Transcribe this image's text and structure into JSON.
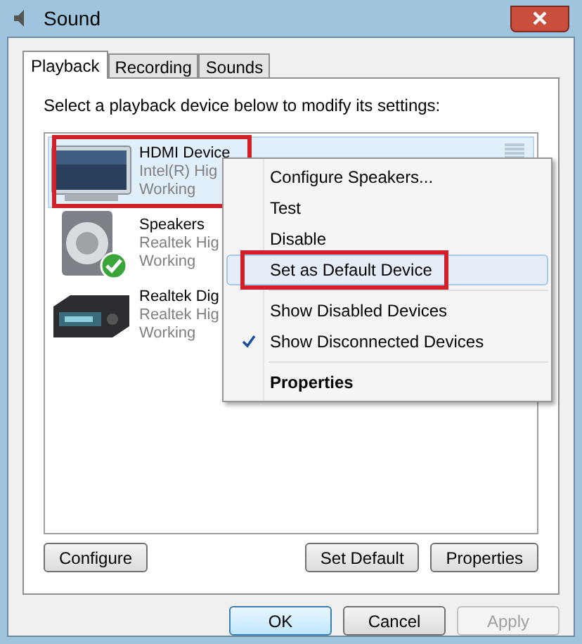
{
  "window": {
    "title": "Sound"
  },
  "tabs": [
    {
      "label": "Playback",
      "selected": true
    },
    {
      "label": "Recording",
      "selected": false
    },
    {
      "label": "Sounds",
      "selected": false
    }
  ],
  "instruction": "Select a playback device below to modify its settings:",
  "devices": [
    {
      "kind": "monitor",
      "name": "HDMI Device",
      "driver": "Intel(R) Hig",
      "status": "Working",
      "selected": true,
      "default": false,
      "highlighted": true
    },
    {
      "kind": "speaker",
      "name": "Speakers",
      "driver": "Realtek Hig",
      "status": "Working",
      "selected": false,
      "default": true,
      "highlighted": false
    },
    {
      "kind": "receiver",
      "name": "Realtek Dig",
      "driver": "Realtek Hig",
      "status": "Working",
      "selected": false,
      "default": false,
      "highlighted": false
    }
  ],
  "context_menu": [
    {
      "kind": "item",
      "label": "Configure Speakers...",
      "checked": false,
      "hovered": false,
      "bold": false,
      "highlighted": false
    },
    {
      "kind": "item",
      "label": "Test",
      "checked": false,
      "hovered": false,
      "bold": false,
      "highlighted": false
    },
    {
      "kind": "item",
      "label": "Disable",
      "checked": false,
      "hovered": false,
      "bold": false,
      "highlighted": false
    },
    {
      "kind": "item",
      "label": "Set as Default Device",
      "checked": false,
      "hovered": true,
      "bold": false,
      "highlighted": true
    },
    {
      "kind": "separator"
    },
    {
      "kind": "item",
      "label": "Show Disabled Devices",
      "checked": false,
      "hovered": false,
      "bold": false,
      "highlighted": false
    },
    {
      "kind": "item",
      "label": "Show Disconnected Devices",
      "checked": true,
      "hovered": false,
      "bold": false,
      "highlighted": false
    },
    {
      "kind": "separator"
    },
    {
      "kind": "item",
      "label": "Properties",
      "checked": false,
      "hovered": false,
      "bold": true,
      "highlighted": false
    }
  ],
  "panel_buttons": [
    {
      "label": "Configure",
      "disabled": false
    },
    {
      "label": "Set Default",
      "disabled": false
    },
    {
      "label": "Properties",
      "disabled": false
    }
  ],
  "dialog_buttons": [
    {
      "label": "OK",
      "disabled": false,
      "focused": true
    },
    {
      "label": "Cancel",
      "disabled": false,
      "focused": false
    },
    {
      "label": "Apply",
      "disabled": true,
      "focused": false
    }
  ]
}
